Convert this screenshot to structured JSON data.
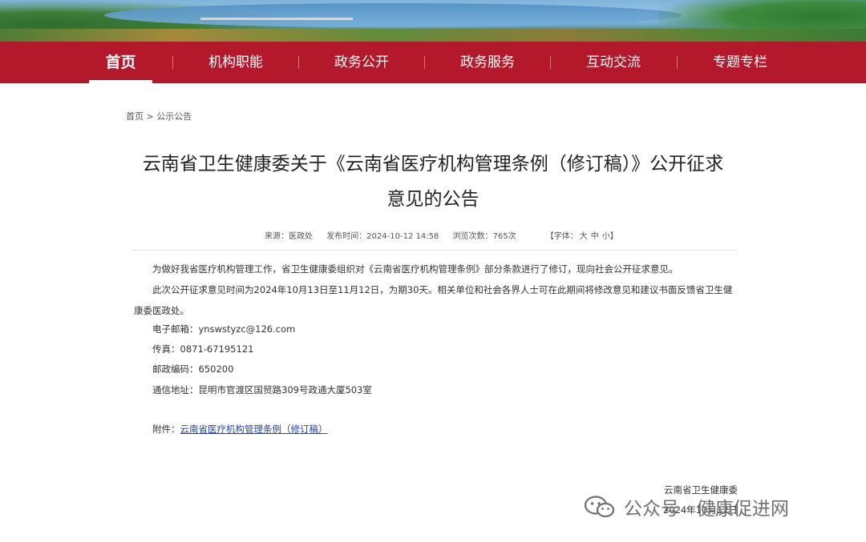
{
  "nav": {
    "items": [
      "首页",
      "机构职能",
      "政务公开",
      "政务服务",
      "互动交流",
      "专题专栏"
    ]
  },
  "breadcrumb": {
    "home": "首页",
    "separator": ">",
    "current": "公示公告"
  },
  "article": {
    "title_line1": "云南省卫生健康委关于《云南省医疗机构管理条例（修订稿）》公开征求",
    "title_line2": "意见的公告",
    "meta": {
      "source": "来源：医政处",
      "published": "发布时间：2024-10-12 14:58",
      "views": "浏览次数：765次",
      "font_label": "【字体：",
      "font_large": "大",
      "font_medium": "中",
      "font_small": "小】"
    },
    "para1": "为做好我省医疗机构管理工作，省卫生健康委组织对《云南省医疗机构管理条例》部分条款进行了修订，现向社会公开征求意见。",
    "para2": "此次公开征求意见时间为2024年10月13日至11月12日，为期30天。相关单位和社会各界人士可在此期间将修改意见和建议书面反馈省卫生健康委医政处。",
    "contacts": [
      "电子邮箱：ynswstyzc@126.com",
      "传真：0871-67195121",
      "邮政编码：650200",
      "通信地址：昆明市官渡区国贸路309号政通大厦503室"
    ],
    "attachment_label": "附件：",
    "attachment_link": "云南省医疗机构管理条例（修订稿）",
    "signature_org": "云南省卫生健康委",
    "signature_date": "2024年10月12日"
  },
  "watermark": "公众号 · 健康促进网",
  "colors": {
    "nav_bg": "#b3192a",
    "link": "#2346a3"
  }
}
